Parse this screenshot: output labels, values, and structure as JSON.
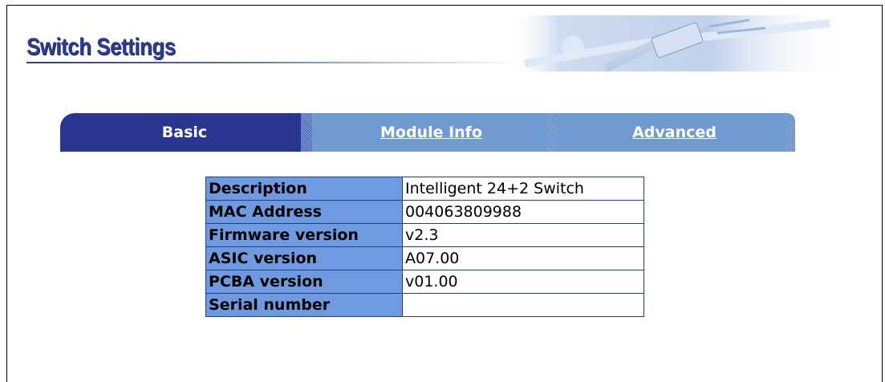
{
  "page": {
    "title": "Switch Settings"
  },
  "tabs": [
    {
      "label": "Basic",
      "active": true
    },
    {
      "label": "Module Info",
      "active": false
    },
    {
      "label": "Advanced",
      "active": false
    }
  ],
  "info": {
    "rows": [
      {
        "key": "Description",
        "value": "Intelligent 24+2 Switch"
      },
      {
        "key": "MAC Address",
        "value": "004063809988"
      },
      {
        "key": "Firmware version",
        "value": "v2.3"
      },
      {
        "key": "ASIC version",
        "value": "A07.00"
      },
      {
        "key": "PCBA version",
        "value": "v01.00"
      },
      {
        "key": "Serial number",
        "value": ""
      }
    ]
  },
  "colors": {
    "title": "#2e3c8c",
    "tab_active": "#2a3590",
    "tab_inactive": "#6f9ad2",
    "table_key_bg": "#6f9ae0",
    "table_border": "#1f3d8c"
  }
}
